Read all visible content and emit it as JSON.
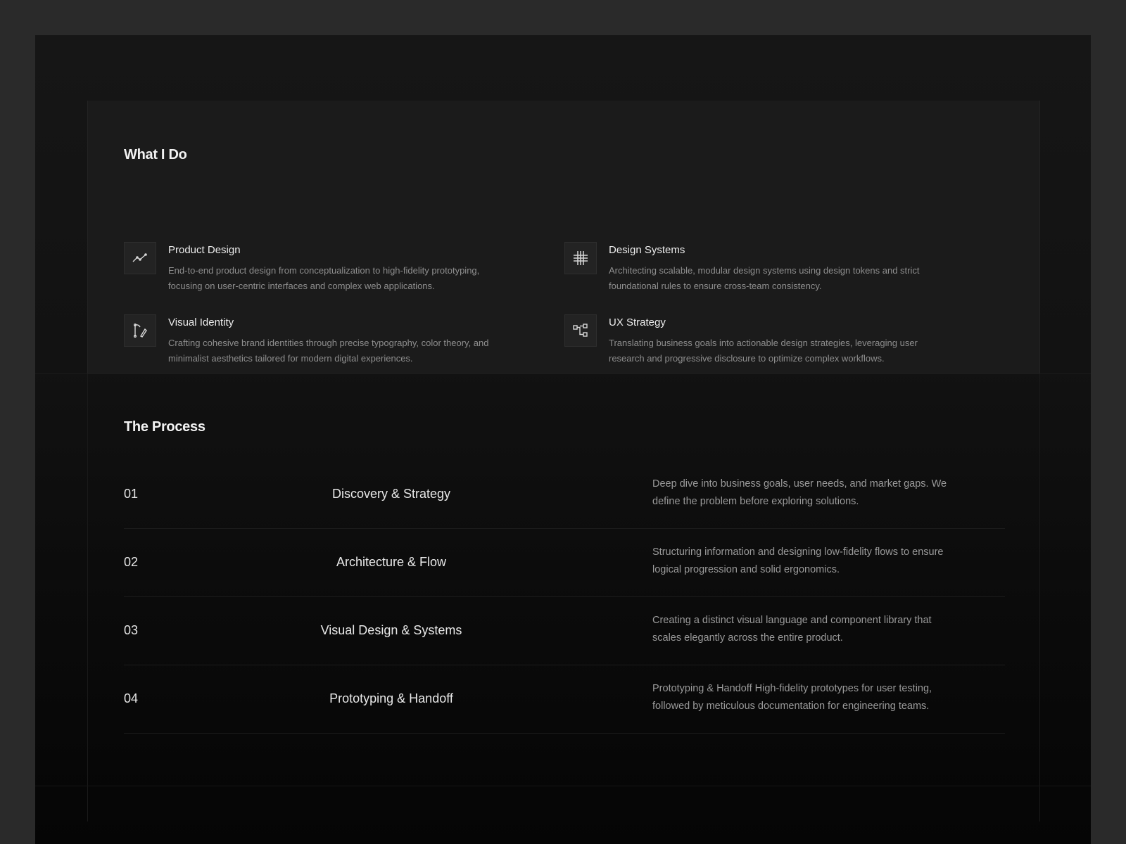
{
  "services": {
    "title": "What I Do",
    "items": [
      {
        "title": "Product Design",
        "icon": "chart-line-icon",
        "description": "End-to-end product design from conceptualization to high-fidelity prototyping, focusing on user-centric interfaces and complex web applications."
      },
      {
        "title": "Design Systems",
        "icon": "grid-icon",
        "description": "Architecting scalable, modular design systems using design tokens and strict foundational rules to ensure cross-team consistency."
      },
      {
        "title": "Visual Identity",
        "icon": "pen-tool-icon",
        "description": "Crafting cohesive brand identities through precise typography, color theory, and minimalist aesthetics tailored for modern digital experiences."
      },
      {
        "title": "UX Strategy",
        "icon": "flow-diagram-icon",
        "description": "Translating business goals into actionable design strategies, leveraging user research and progressive disclosure to optimize complex workflows."
      }
    ]
  },
  "process": {
    "title": "The Process",
    "steps": [
      {
        "number": "01",
        "title": "Discovery & Strategy",
        "description": "Deep dive into business goals, user needs, and market gaps. We define the problem before exploring solutions."
      },
      {
        "number": "02",
        "title": "Architecture & Flow",
        "description": "Structuring information and designing low-fidelity flows to ensure logical progression and solid ergonomics."
      },
      {
        "number": "03",
        "title": "Visual Design & Systems",
        "description": "Creating a distinct visual language and component library that scales elegantly across the entire product."
      },
      {
        "number": "04",
        "title": "Prototyping & Handoff",
        "description": "Prototyping & Handoff High-fidelity prototypes for user testing, followed by meticulous documentation for engineering teams."
      }
    ]
  }
}
